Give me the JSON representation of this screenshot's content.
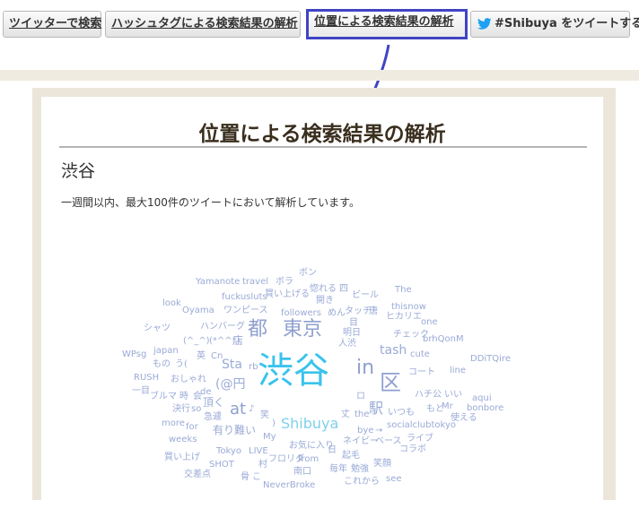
{
  "tabs": {
    "search_twitter": "ツイッターで検索",
    "hashtag_analysis": "ハッシュタグによる検索結果の解析",
    "location_analysis": "位置による検索結果の解析",
    "tweet_hashtag": "#Shibuya をツイートする"
  },
  "accent_colors": {
    "annotation": "#3f44c4",
    "twitter_blue": "#1da1f2",
    "cloud_main": "#3ac3ec",
    "cloud_word": "#8fa6d2"
  },
  "main": {
    "title": "位置による検索結果の解析",
    "place_name": "渋谷",
    "description": "一週間以内、最大100件のツイートにおいて解析しています。"
  },
  "word_cloud": [
    "Yamanote",
    "travel",
    "ボラ",
    "ボン",
    "fuckusluts",
    "買い上げる",
    "惚れる",
    "四",
    "開き",
    "ビール",
    "The",
    "look",
    "Oyama",
    "ワンピース",
    "followers",
    "めん",
    "タッチ",
    "唐",
    "thisnow",
    "シャツ",
    "ハンバーグ",
    "目",
    "ヒカリエ",
    "one",
    "都",
    "東京",
    "明日",
    "チェック",
    "brhQonM",
    "(^_^)",
    "(*^^*)",
    "店",
    "人渋",
    "japan",
    "WPsg",
    "英",
    "Cn",
    "tash",
    "cute",
    "もの",
    "う(",
    "Sta",
    "rb",
    "DDiTQire",
    "RUSH",
    "おしゃれ",
    "渋谷",
    "in",
    "line",
    "区",
    "コート",
    "(@円",
    "一目",
    "ブルマ",
    "時",
    "会",
    "頂く",
    "ロ",
    "ハチ公",
    "いい",
    "aqui",
    "決行",
    "so",
    "de",
    "at",
    "♪",
    "駅",
    "Mr",
    "もと",
    "bonbore",
    "急遽",
    "笑",
    "丈",
    "the",
    "いつも",
    "使える",
    "more",
    "for",
    "Shibuya",
    ")",
    "有り難い",
    "bye",
    "→",
    "socialclubtokyo",
    "weeks",
    "My",
    "お気に入り",
    "ネイビー",
    "ベース",
    "ライブ",
    "Tokyo",
    "LIVE",
    "日",
    "コラボ",
    "買い上げ",
    "SHOT",
    "村",
    "フロリダ",
    "起毛",
    "交差点",
    "from",
    "毎年",
    "勉強",
    "笑顔",
    "骨",
    "こ",
    "南口",
    "これから",
    "see",
    "NeverBroke"
  ]
}
